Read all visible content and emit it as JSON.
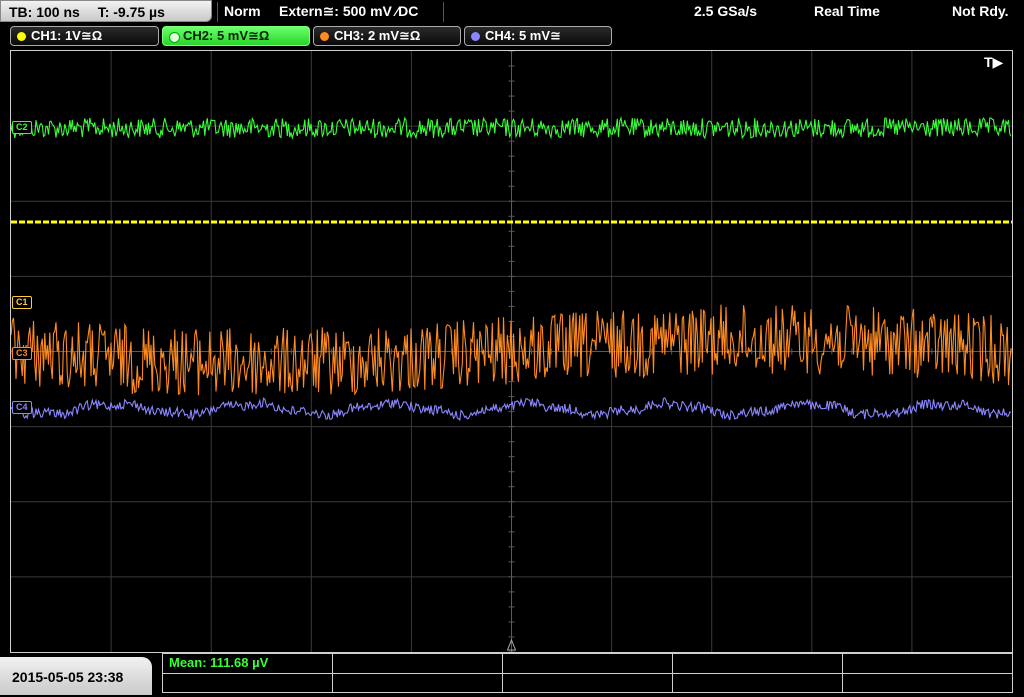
{
  "statusbar": {
    "timebase": "TB: 100 ns",
    "trigger_time": "T: -9.75 µs",
    "mode": "Norm",
    "trigger_source": "Extern≅: 500 mV ⁄DC",
    "sample_rate": "2.5 GSa/s",
    "acq_mode": "Real Time",
    "state": "Not Rdy."
  },
  "channels": [
    {
      "label": "CH1: 1V≅Ω",
      "color": "#ffff00"
    },
    {
      "label": "CH2: 5 mV≅Ω",
      "color": "#39ff39"
    },
    {
      "label": "CH3: 2 mV≅Ω",
      "color": "#ff8a1f"
    },
    {
      "label": "CH4: 5 mV≅",
      "color": "#8a86ff"
    }
  ],
  "markers": {
    "ch1": "C1",
    "ch2": "C2",
    "ch3": "C3",
    "ch4": "C4",
    "trigger": "T▶"
  },
  "measurement": {
    "mean": "Mean: 111.68 µV"
  },
  "datetime": "2015-05-05 23:38"
}
